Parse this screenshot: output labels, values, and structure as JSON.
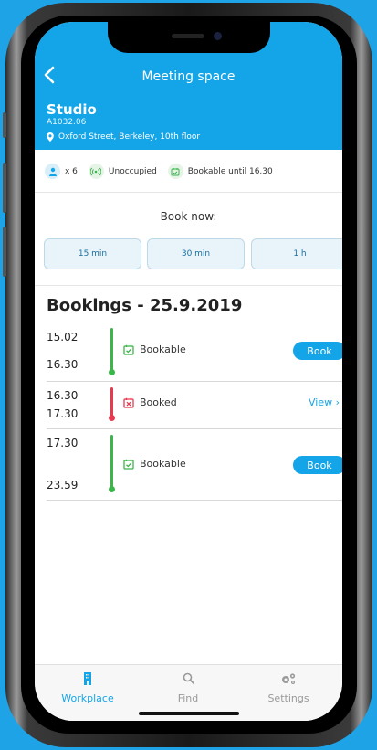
{
  "header": {
    "title": "Meeting space",
    "room_name": "Studio",
    "room_code": "A1032.06",
    "address": "Oxford Street, Berkeley, 10th floor"
  },
  "info": {
    "capacity": "x 6",
    "occupancy": "Unoccupied",
    "bookable": "Bookable until 16.30"
  },
  "book_now": {
    "label": "Book now:",
    "options": [
      "15 min",
      "30 min",
      "1 h"
    ]
  },
  "bookings": {
    "title": "Bookings - 25.9.2019",
    "rows": [
      {
        "start": "15.02",
        "end": "16.30",
        "status": "Bookable",
        "action": "Book"
      },
      {
        "start": "16.30",
        "end": "17.30",
        "status": "Booked",
        "action": "View ›"
      },
      {
        "start": "17.30",
        "end": "23.59",
        "status": "Bookable",
        "action": "Book"
      }
    ]
  },
  "tabs": [
    {
      "label": "Workplace",
      "active": true
    },
    {
      "label": "Find",
      "active": false
    },
    {
      "label": "Settings",
      "active": false
    }
  ],
  "colors": {
    "brand": "#14a5e8",
    "bookable": "#3cb54a",
    "booked": "#e8394f",
    "background": "#1ea3e6"
  }
}
